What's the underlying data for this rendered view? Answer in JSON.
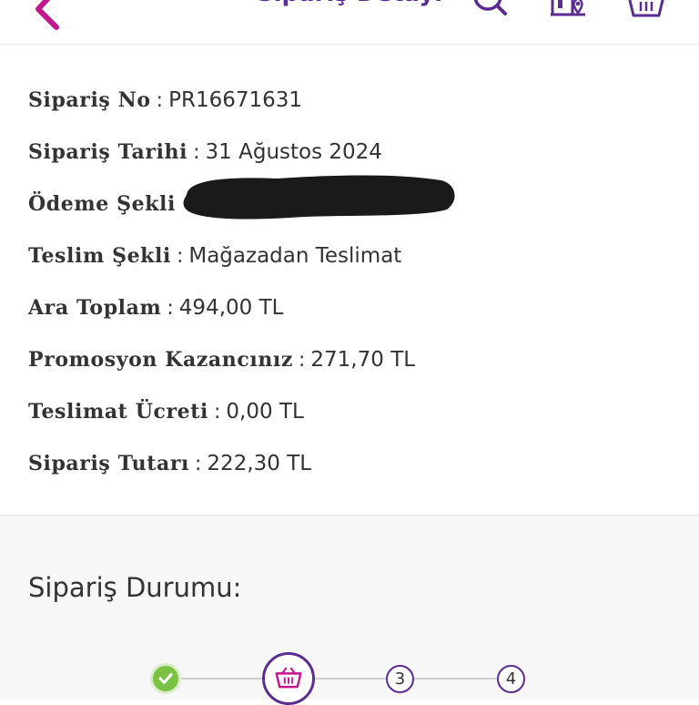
{
  "header": {
    "title": "Sipariş Detayı",
    "icons": [
      "back-icon",
      "search-icon",
      "store-location-icon",
      "basket-icon"
    ],
    "accent_color": "#5c2d91",
    "back_color": "#c4168d"
  },
  "details": {
    "separator": ":",
    "order_no": {
      "label": "Sipariş No",
      "value": "PR16671631"
    },
    "order_date": {
      "label": "Sipariş Tarihi",
      "value": "31 Ağustos 2024"
    },
    "payment": {
      "label": "Ödeme Şekli"
    },
    "delivery": {
      "label": "Teslim Şekli",
      "value": "Mağazadan Teslimat"
    },
    "subtotal": {
      "label": "Ara Toplam",
      "value": "494,00 TL"
    },
    "promotion": {
      "label": "Promosyon Kazancınız",
      "value": "271,70 TL"
    },
    "delivery_fee": {
      "label": "Teslimat Ücreti",
      "value": "0,00 TL"
    },
    "total": {
      "label": "Sipariş Tutarı",
      "value": "222,30 TL"
    }
  },
  "status": {
    "title": "Sipariş Durumu:",
    "steps": [
      {
        "state": "completed",
        "icon": "check-icon"
      },
      {
        "state": "current",
        "icon": "basket-icon"
      },
      {
        "state": "pending",
        "number": "3"
      },
      {
        "state": "pending",
        "number": "4"
      }
    ],
    "complete_color": "#7cc242"
  }
}
